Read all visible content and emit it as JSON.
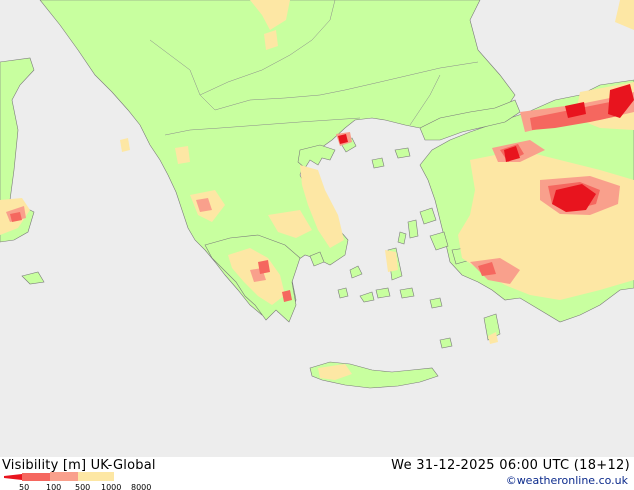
{
  "title": {
    "product": "Visibility [m]",
    "model": "UK-Global",
    "valid_time": "We 31-12-2025 06:00 UTC (18+12)"
  },
  "credit": "©weatheronline.co.uk",
  "legend": {
    "ticks": [
      "50",
      "100",
      "500",
      "1000",
      "8000"
    ],
    "colors": [
      "#e8141e",
      "#f5675f",
      "#f9a08c",
      "#fde7a4",
      "#c8ff9f"
    ]
  },
  "map_colors": {
    "sea": "#ededed",
    "land_good_visibility": "#c8ff9f",
    "visibility_1000_8000": "#fde7a4",
    "visibility_500_1000": "#f9a08c",
    "visibility_100_500": "#f5675f",
    "visibility_below_100": "#e8141e",
    "coastline": "#7a7a7a"
  }
}
